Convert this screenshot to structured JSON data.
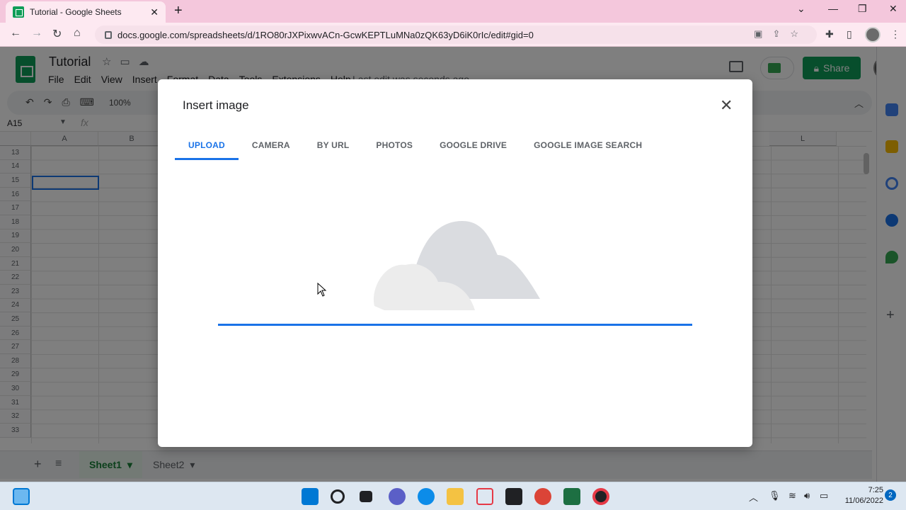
{
  "browser": {
    "tab_title": "Tutorial - Google Sheets",
    "tab_close": "✕",
    "new_tab": "+",
    "url": "docs.google.com/spreadsheets/d/1RO80rJXPixwvACn-GcwKEPTLuMNa0zQK63yD6iK0rIc/edit#gid=0",
    "window_controls": {
      "minimize": "—",
      "restore": "❐",
      "close": "✕",
      "tab_list": "⌄"
    }
  },
  "sheets": {
    "doc_title": "Tutorial",
    "menu": [
      "File",
      "Edit",
      "View",
      "Insert",
      "Format",
      "Data",
      "Tools",
      "Extensions",
      "Help"
    ],
    "last_edit": "Last edit was seconds ago",
    "share_label": "Share",
    "zoom": "100%",
    "name_box": "A15",
    "fx": "fx",
    "columns": [
      "A",
      "B",
      "L"
    ],
    "rows": [
      "13",
      "14",
      "15",
      "16",
      "17",
      "18",
      "19",
      "20",
      "21",
      "22",
      "23",
      "24",
      "25",
      "26",
      "27",
      "28",
      "29",
      "30",
      "31",
      "32",
      "33"
    ],
    "sheet_tabs": [
      "Sheet1",
      "Sheet2"
    ]
  },
  "dialog": {
    "title": "Insert image",
    "close": "✕",
    "tabs": [
      "UPLOAD",
      "CAMERA",
      "BY URL",
      "PHOTOS",
      "GOOGLE DRIVE",
      "GOOGLE IMAGE SEARCH"
    ],
    "active_tab": "UPLOAD",
    "upload_progress": 1.0
  },
  "taskbar": {
    "time": "7:25",
    "date": "11/06/2022",
    "notifications": "2"
  },
  "colors": {
    "accent": "#1a73e8",
    "sheets_green": "#0f9d58",
    "tab_strip": "#f4c7dc"
  }
}
